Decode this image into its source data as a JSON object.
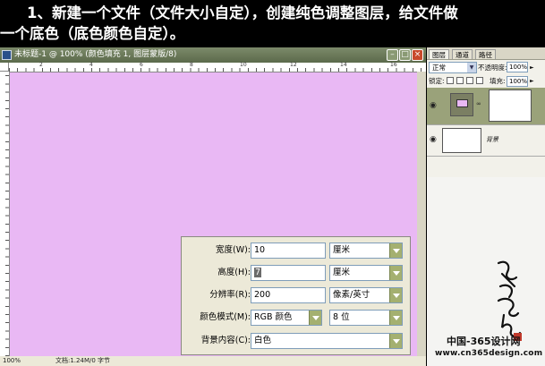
{
  "banner": {
    "line1": "1、新建一个文件（文件大小自定），创建纯色调整图层，给文件做",
    "line2": "一个底色（底色颜色自定）。"
  },
  "document": {
    "title": "未标题-1 @ 100% (颜色填充 1, 图层蒙版/8)",
    "canvas_color": "#e9b8f4",
    "ruler_labels": [
      "2",
      "4",
      "6",
      "8",
      "10",
      "12",
      "14",
      "16"
    ],
    "zoom": "100%",
    "doc_info": "文档:1.24M/0 字节"
  },
  "layers_panel": {
    "tabs": [
      "图层",
      "通道",
      "路径"
    ],
    "blend_mode": "正常",
    "opacity_label": "不透明度:",
    "opacity_value": "100%",
    "lock_label": "锁定:",
    "fill_label": "填充:",
    "fill_value": "100%",
    "layers": [
      {
        "name": "",
        "thumb_color": "#e9b8f4",
        "selected": true
      },
      {
        "name": "背景",
        "thumb_color": "#ffffff",
        "selected": false
      }
    ]
  },
  "dialog": {
    "width_label": "宽度(W):",
    "width_value": "10",
    "width_unit": "厘米",
    "height_label": "高度(H):",
    "height_value": "7",
    "height_unit": "厘米",
    "resolution_label": "分辨率(R):",
    "resolution_value": "200",
    "resolution_unit": "像素/英寸",
    "mode_label": "颜色模式(M):",
    "mode_value": "RGB 颜色",
    "depth_value": "8 位",
    "bg_label": "背景内容(C):",
    "bg_value": "白色"
  },
  "watermark": {
    "line1": "中国-365设计网",
    "line2": "www.cn365design.com"
  },
  "colors": {
    "canvas": "#e9b8f4",
    "titlebar": "#6b7a5a",
    "dropdown_arrow": "#a4b070"
  }
}
